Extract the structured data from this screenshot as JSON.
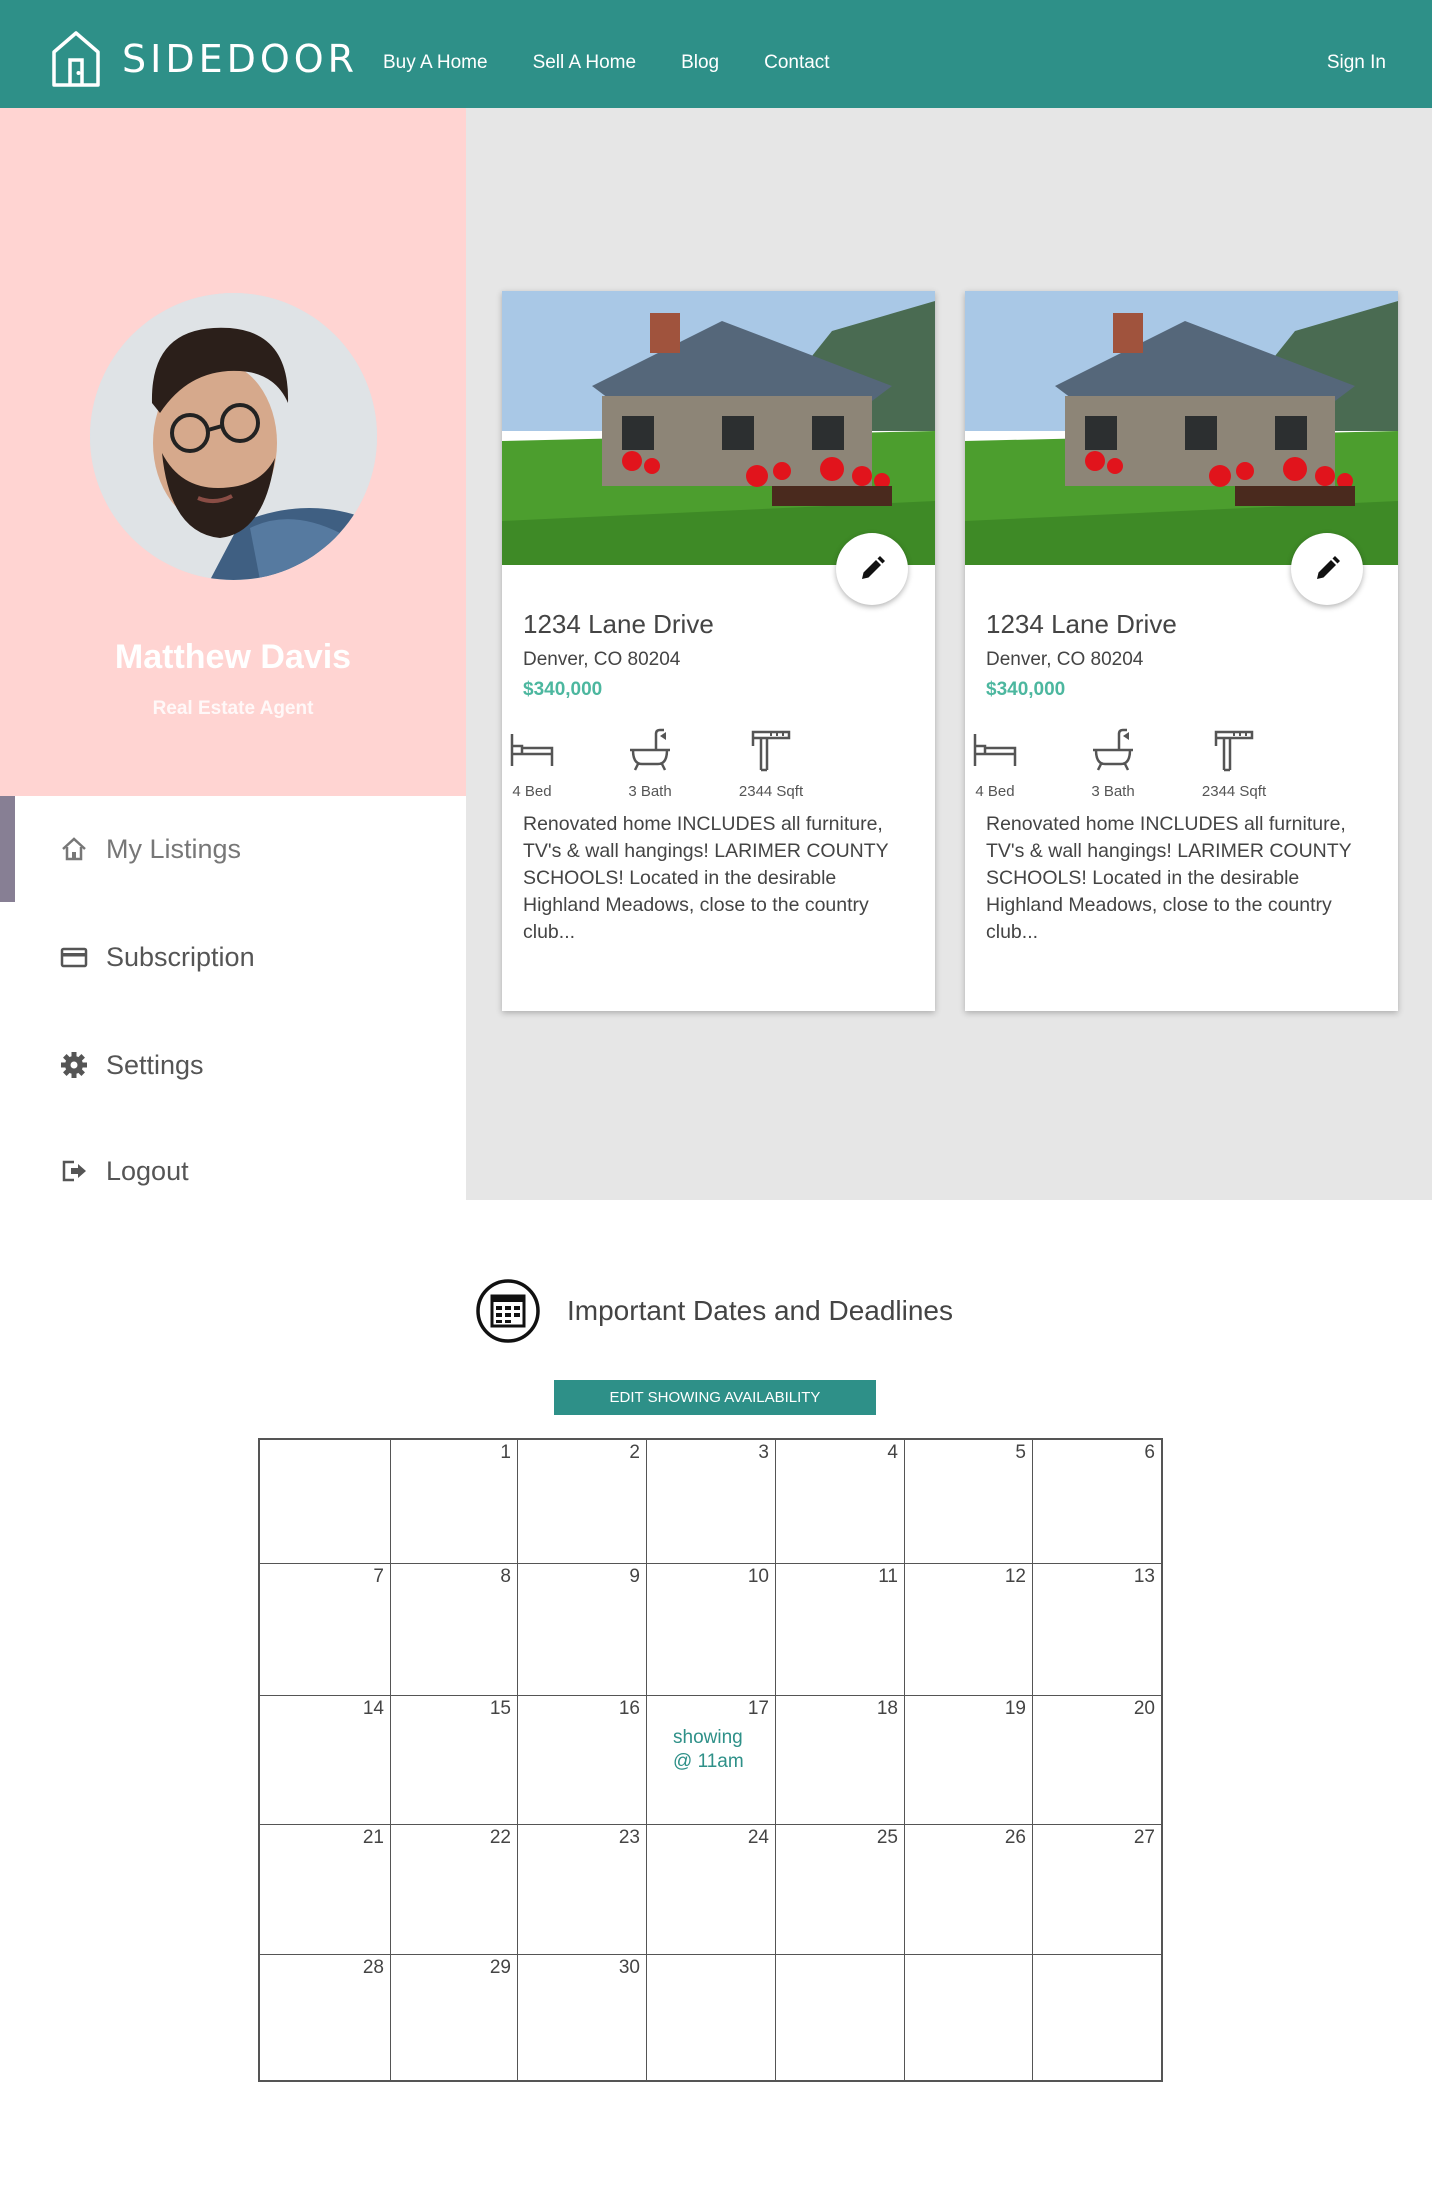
{
  "brand": {
    "name": "SIDEDOOR",
    "accent": "#2e9088",
    "price_color": "#4cb79f"
  },
  "nav": {
    "links": [
      "Buy A Home",
      "Sell A Home",
      "Blog",
      "Contact"
    ],
    "signin": "Sign In"
  },
  "profile": {
    "name": "Matthew Davis",
    "role": "Real Estate Agent",
    "bg_color": "#ffd4d2"
  },
  "menu": [
    {
      "label": "My Listings",
      "icon": "home-icon",
      "active": true
    },
    {
      "label": "Subscription",
      "icon": "credit-card-icon",
      "active": false
    },
    {
      "label": "Settings",
      "icon": "gear-icon",
      "active": false
    },
    {
      "label": "Logout",
      "icon": "logout-icon",
      "active": false
    }
  ],
  "listings": [
    {
      "title": "1234 Lane Drive",
      "address": "Denver, CO 80204",
      "price": "$340,000",
      "beds": "4 Bed",
      "baths": "3 Bath",
      "sqft": "2344 Sqft",
      "description": "Renovated home INCLUDES all furniture, TV's & wall hangings!  LARIMER COUNTY SCHOOLS! Located in the desirable Highland Meadows, close to the country club..."
    },
    {
      "title": "1234 Lane Drive",
      "address": "Denver, CO 80204",
      "price": "$340,000",
      "beds": "4 Bed",
      "baths": "3 Bath",
      "sqft": "2344 Sqft",
      "description": "Renovated home INCLUDES all furniture, TV's & wall hangings!  LARIMER COUNTY SCHOOLS! Located in the desirable Highland Meadows, close to the country club..."
    }
  ],
  "dates": {
    "title": "Important Dates and Deadlines",
    "button": "EDIT SHOWING AVAILABILITY",
    "calendar": {
      "first_weekday_offset": 1,
      "days_in_month": 30,
      "events": [
        {
          "day": 17,
          "text": "showing @ 11am"
        }
      ]
    }
  }
}
